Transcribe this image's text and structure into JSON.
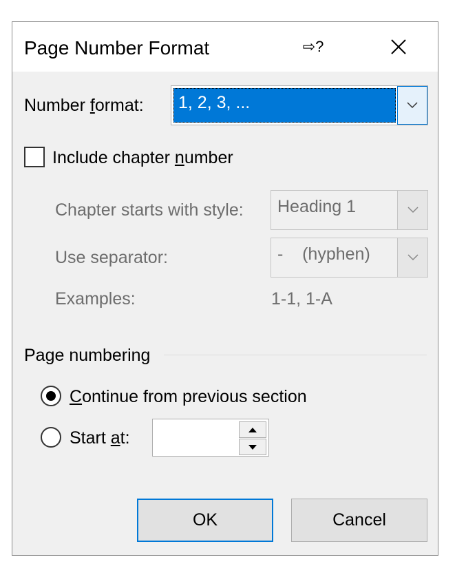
{
  "dialog": {
    "title": "Page Number Format",
    "help_glyph": "⇨?",
    "number_format": {
      "label_pre": "Number ",
      "label_key": "f",
      "label_post": "ormat:",
      "value": "1, 2, 3, ..."
    },
    "include_chapter": {
      "label_pre": "Include chapter ",
      "label_key": "n",
      "label_post": "umber",
      "checked": false
    },
    "chapter_style": {
      "label": "Chapter starts with style:",
      "value": "Heading 1"
    },
    "separator": {
      "label": "Use separator:",
      "value": "-    (hyphen)"
    },
    "examples": {
      "label": "Examples:",
      "value": "1-1, 1-A"
    },
    "page_numbering": {
      "heading": "Page numbering",
      "continue": {
        "label_key": "C",
        "label_post": "ontinue from previous section",
        "selected": true
      },
      "start_at": {
        "label_pre": "Start ",
        "label_key": "a",
        "label_post": "t:",
        "value": ""
      }
    },
    "buttons": {
      "ok": "OK",
      "cancel": "Cancel"
    }
  }
}
